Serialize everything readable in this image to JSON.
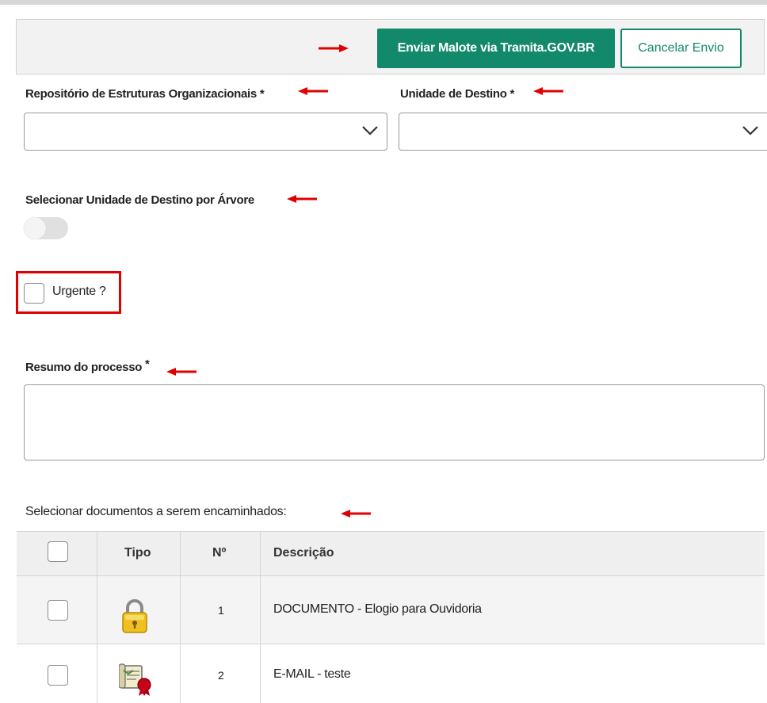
{
  "toolbar": {
    "send_label": "Enviar Malote via Tramita.GOV.BR",
    "cancel_label": "Cancelar Envio"
  },
  "form": {
    "repositorio_label": "Repositório de Estruturas Organizacionais",
    "repositorio_value": "",
    "unidade_label": "Unidade de Destino",
    "unidade_value": "",
    "required_mark": "*",
    "arvore_label": "Selecionar Unidade de Destino por Árvore",
    "arvore_toggle_on": false,
    "urgente_label": "Urgente ?",
    "urgente_checked": false,
    "resumo_label": "Resumo do processo",
    "resumo_value": "",
    "documentos_label": "Selecionar documentos a serem encaminhados:"
  },
  "table": {
    "headers": [
      "Tipo",
      "Nº",
      "Descrição"
    ],
    "rows": [
      {
        "num": "1",
        "descricao": "DOCUMENTO - Elogio para Ouvidoria",
        "icon": "padlock-icon",
        "checked": false
      },
      {
        "num": "2",
        "descricao": "E-MAIL - teste",
        "icon": "certified-email-icon",
        "checked": false
      }
    ]
  },
  "colors": {
    "primary": "#13896b",
    "annotation_red": "#e00000"
  }
}
